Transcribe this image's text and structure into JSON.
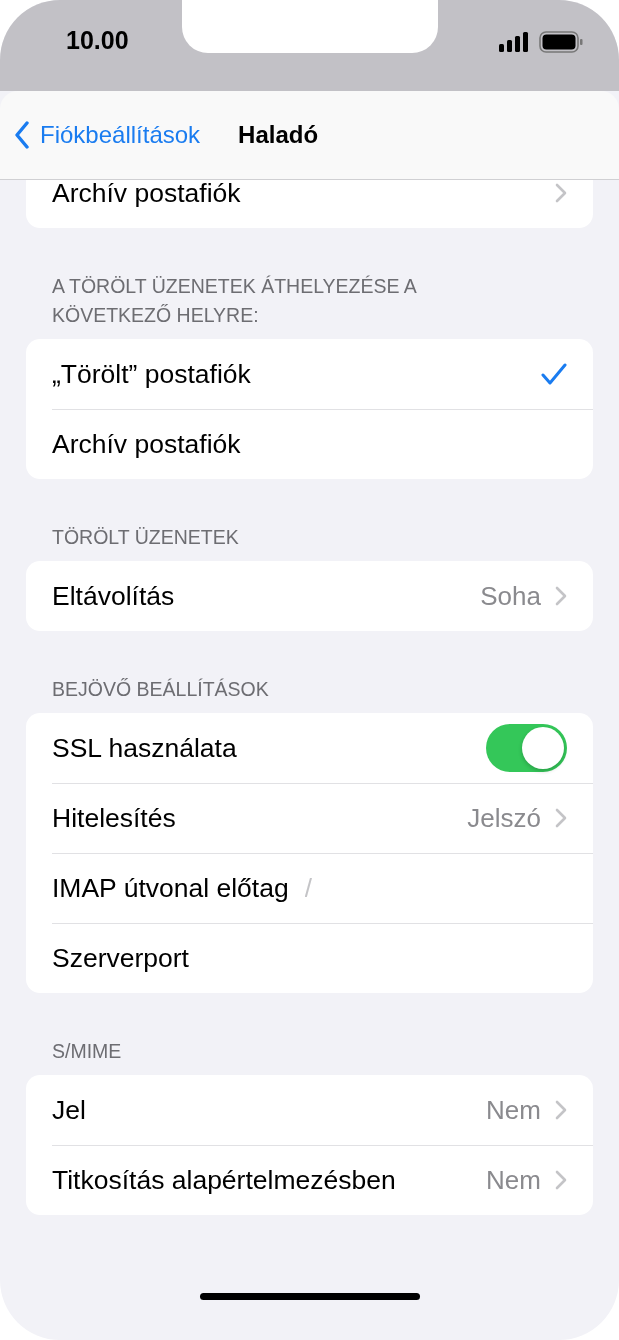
{
  "status_bar": {
    "time": "10.00"
  },
  "nav": {
    "back": "Fiókbeállítások",
    "title": "Haladó"
  },
  "groups": [
    {
      "rows": [
        {
          "kind": "link",
          "label": "Archív postafiók"
        }
      ]
    },
    {
      "header": "A TÖRÖLT ÜZENETEK ÁTHELYEZÉSE A KÖVETKEZŐ HELYRE:",
      "rows": [
        {
          "kind": "check",
          "label": "„Törölt” postafiók",
          "selected": true
        },
        {
          "kind": "check",
          "label": "Archív postafiók",
          "selected": false
        }
      ]
    },
    {
      "header": "TÖRÖLT ÜZENETEK",
      "rows": [
        {
          "kind": "value",
          "label": "Eltávolítás",
          "value": "Soha"
        }
      ]
    },
    {
      "header": "BEJÖVŐ BEÁLLÍTÁSOK",
      "rows": [
        {
          "kind": "toggle",
          "label": "SSL használata",
          "on": true
        },
        {
          "kind": "value",
          "label": "Hitelesítés",
          "value": "Jelszó"
        },
        {
          "kind": "field",
          "label": "IMAP útvonal előtag",
          "placeholder": "/"
        },
        {
          "kind": "field",
          "label": "Szerverport"
        }
      ]
    },
    {
      "header": "S/MIME",
      "rows": [
        {
          "kind": "value",
          "label": "Jel",
          "value": "Nem"
        },
        {
          "kind": "value",
          "label": "Titkosítás alapértelmezésben",
          "value": "Nem"
        }
      ]
    }
  ]
}
